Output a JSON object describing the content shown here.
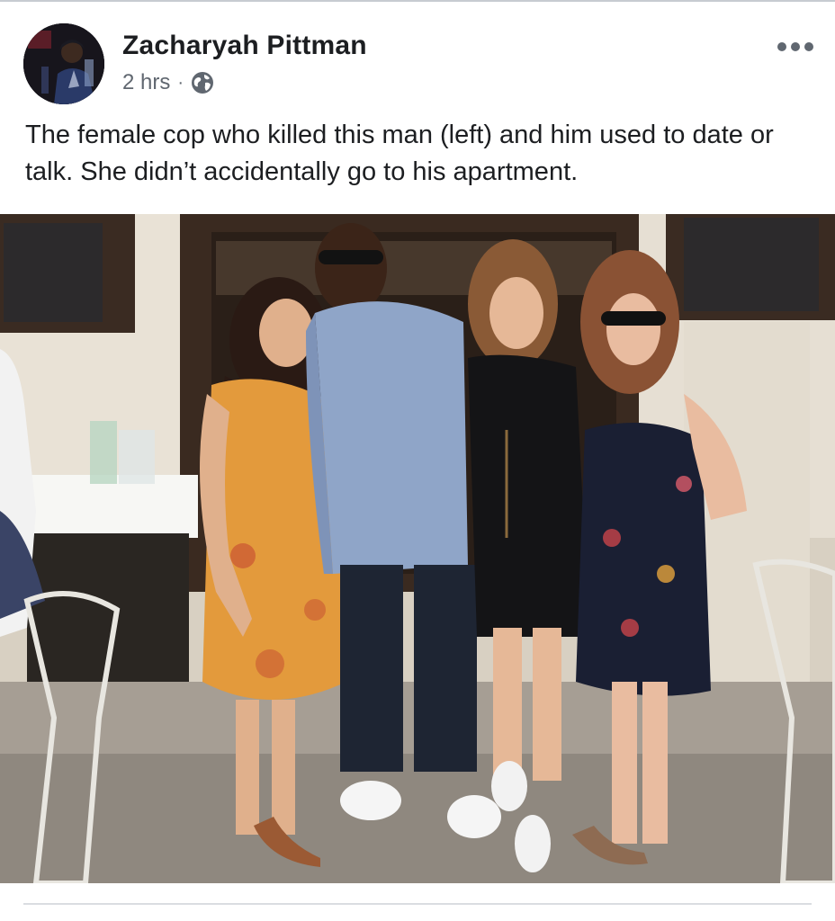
{
  "post": {
    "author": {
      "name": "Zacharyah Pittman"
    },
    "meta": {
      "time": "2 hrs",
      "separator": "·",
      "audience_icon": "globe-icon"
    },
    "more_icon": "more-dots-icon",
    "text": "The female cop who killed this man (left) and him used to date or talk. She didn’t accidentally go to his apartment.",
    "colors": {
      "name": "#1c1e21",
      "meta": "#606770",
      "divider": "#dadde1"
    }
  }
}
